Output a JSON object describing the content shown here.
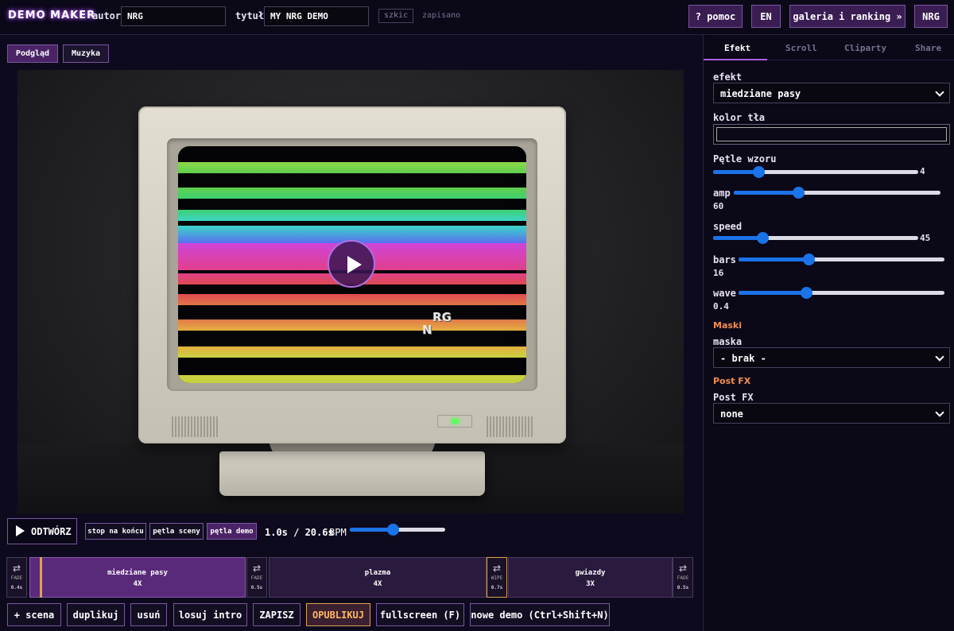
{
  "app": {
    "logo": "DEMO MAKER"
  },
  "header": {
    "author_label": "autor",
    "author_value": "NRG",
    "title_label": "tytuł",
    "title_value": "MY NRG DEMO",
    "draft_chip": "szkic",
    "saved_status": "zapisano",
    "help_button": "? pomoc",
    "lang_button": "EN",
    "gallery_button": "galeria i ranking »",
    "user_button": "NRG"
  },
  "view_tabs": [
    {
      "label": "Podgląd",
      "active": true
    },
    {
      "label": "Muzyka",
      "active": false
    }
  ],
  "preview": {
    "overlay_text_a": "RG",
    "overlay_text_b": "N",
    "bar_colors": [
      "#8ed84a",
      "#5fcf4e",
      "#3fd070",
      "#3ad6c8",
      "#5a6ef0",
      "#d044d8",
      "#e0408a",
      "#e04a52",
      "#e07848",
      "#e6b040",
      "#c8d040"
    ]
  },
  "transport": {
    "play_label": "ODTWÓRZ",
    "loop_options": [
      {
        "label": "stop na końcu",
        "active": false
      },
      {
        "label": "pętla sceny",
        "active": false
      },
      {
        "label": "pętla demo",
        "active": true
      }
    ],
    "time": "1.0s / 20.6s",
    "bpm_label": "BPM",
    "bpm_slider": 0.45
  },
  "timeline": {
    "transitions": [
      {
        "icon": "⇄",
        "name": "FADE",
        "duration": "0.4s"
      },
      {
        "icon": "⇄",
        "name": "FADE",
        "duration": "0.5s"
      },
      {
        "icon": "⇄",
        "name": "WIPE",
        "duration": "0.7s"
      },
      {
        "icon": "⇄",
        "name": "FADE",
        "duration": "0.5s"
      }
    ],
    "scenes": [
      {
        "name": "miedziane pasy",
        "repeat": "4X",
        "active": true
      },
      {
        "name": "plazma",
        "repeat": "4X",
        "active": false
      },
      {
        "name": "gwiazdy",
        "repeat": "3X",
        "active": false
      }
    ]
  },
  "bottom_buttons": [
    "+ scena",
    "duplikuj",
    "usuń",
    "losuj intro",
    "ZAPISZ",
    "OPUBLIKUJ",
    "fullscreen (F)",
    "nowe demo (Ctrl+Shift+N)"
  ],
  "panel": {
    "tabs": [
      "Efekt",
      "Scroll",
      "Cliparty",
      "Share"
    ],
    "active_tab": "Efekt",
    "effect_label": "efekt",
    "effect_value": "miedziane pasy",
    "bg_color_label": "kolor tła",
    "bg_color": "#0b0818",
    "params": [
      {
        "label": "Pętle wzoru",
        "value": "4",
        "slider": 0.22
      },
      {
        "label": "amp",
        "value": "60",
        "slider": 0.31
      },
      {
        "label": "speed",
        "value": "45",
        "slider": 0.24
      },
      {
        "label": "bars",
        "value": "16",
        "slider": 0.34
      },
      {
        "label": "wave",
        "value": "0.4",
        "slider": 0.33
      }
    ],
    "masks_section": "Maski",
    "mask_label": "maska",
    "mask_value": "- brak -",
    "postfx_section": "Post FX",
    "postfx_label": "Post FX",
    "postfx_value": "none"
  }
}
